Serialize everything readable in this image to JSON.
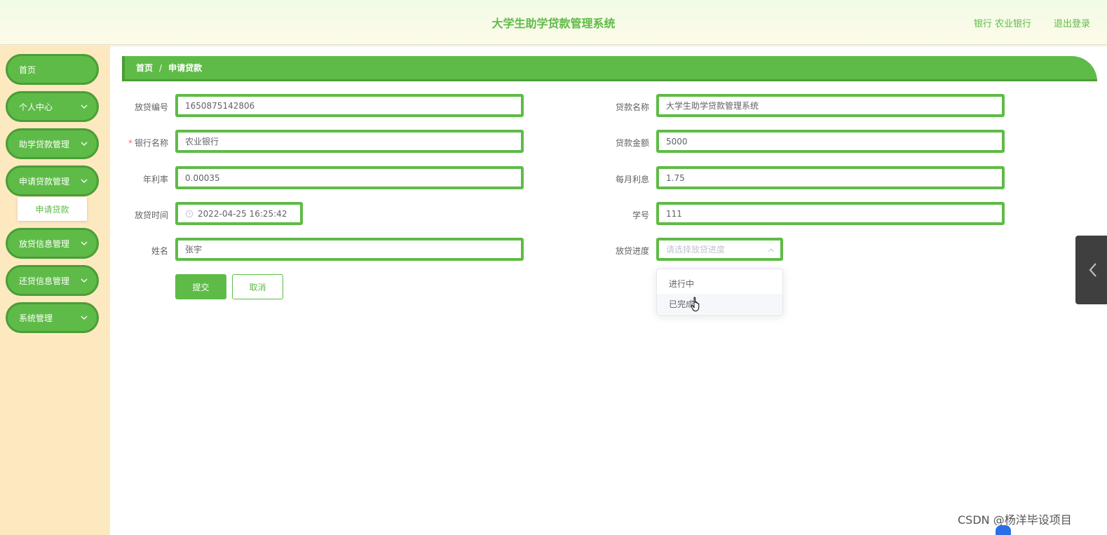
{
  "header": {
    "title": "大学生助学贷款管理系统",
    "user_info": "银行 农业银行",
    "logout": "退出登录"
  },
  "sidebar": {
    "items": [
      {
        "label": "首页",
        "has_children": false
      },
      {
        "label": "个人中心",
        "has_children": true
      },
      {
        "label": "助学贷款管理",
        "has_children": true
      },
      {
        "label": "申请贷款管理",
        "has_children": true
      },
      {
        "label": "放贷信息管理",
        "has_children": true
      },
      {
        "label": "还贷信息管理",
        "has_children": true
      },
      {
        "label": "系统管理",
        "has_children": true
      }
    ],
    "submenu": {
      "label": "申请贷款"
    }
  },
  "breadcrumb": {
    "home": "首页",
    "separator": "/",
    "current": "申请贷款"
  },
  "form": {
    "loan_no": {
      "label": "放贷编号",
      "value": "1650875142806"
    },
    "loan_name": {
      "label": "贷款名称",
      "value": "大学生助学贷款管理系统"
    },
    "bank_name": {
      "label": "银行名称",
      "value": "农业银行",
      "required_mark": "*"
    },
    "loan_amount": {
      "label": "贷款金额",
      "value": "5000"
    },
    "annual_rate": {
      "label": "年利率",
      "value": "0.00035"
    },
    "monthly_interest": {
      "label": "每月利息",
      "value": "1.75"
    },
    "loan_time": {
      "label": "放贷时间",
      "value": "2022-04-25 16:25:42"
    },
    "student_no": {
      "label": "学号",
      "value": "111"
    },
    "name": {
      "label": "姓名",
      "value": "张宇"
    },
    "progress": {
      "label": "放贷进度",
      "placeholder": "请选择放贷进度",
      "options": [
        "进行中",
        "已完成"
      ],
      "hovered": "已完成"
    },
    "submit_label": "提交",
    "cancel_label": "取消"
  },
  "watermark": "CSDN @杨洋毕设项目",
  "colors": {
    "accent": "#5fbb48",
    "accent_dark": "#4a9e37",
    "sidebar_bg": "#fde9c0",
    "handle_bg": "#3f3f3f"
  }
}
